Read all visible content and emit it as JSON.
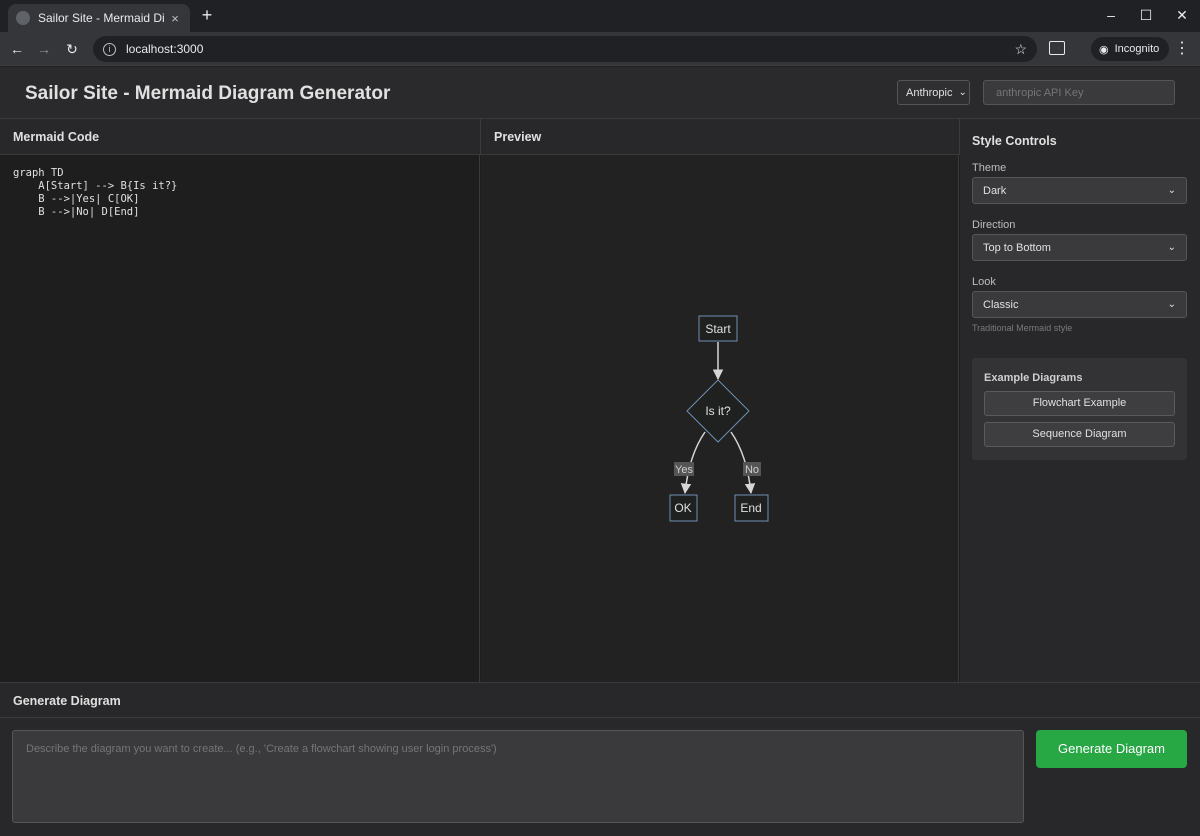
{
  "browser": {
    "tab_title": "Sailor Site - Mermaid Diagram G",
    "tab_close": "×",
    "new_tab": "+",
    "url": "localhost:3000",
    "incognito_label": "Incognito",
    "window_controls": {
      "minimize": "–",
      "maximize": "☐",
      "close": "✕"
    }
  },
  "header": {
    "title": "Sailor Site - Mermaid Diagram Generator",
    "provider": "Anthropic",
    "api_key_placeholder": "anthropic API Key"
  },
  "code_pane": {
    "title": "Mermaid Code",
    "code": "graph TD\n    A[Start] --> B{Is it?}\n    B -->|Yes| C[OK]\n    B -->|No| D[End]"
  },
  "preview": {
    "title": "Preview",
    "nodes": {
      "start": "Start",
      "decision": "Is it?",
      "ok": "OK",
      "end": "End"
    },
    "edge_labels": {
      "yes": "Yes",
      "no": "No"
    }
  },
  "style_controls": {
    "title": "Style Controls",
    "theme": {
      "label": "Theme",
      "value": "Dark"
    },
    "direction": {
      "label": "Direction",
      "value": "Top to Bottom"
    },
    "look": {
      "label": "Look",
      "value": "Classic",
      "hint": "Traditional Mermaid style"
    },
    "examples": {
      "title": "Example Diagrams",
      "flowchart": "Flowchart Example",
      "sequence": "Sequence Diagram"
    }
  },
  "generate": {
    "title": "Generate Diagram",
    "placeholder": "Describe the diagram you want to create... (e.g., 'Create a flowchart showing user login process')",
    "button": "Generate Diagram"
  },
  "colors": {
    "accent_green": "#28a745",
    "node_stroke": "#6e8fb3",
    "node_fill": "#1f2020"
  }
}
